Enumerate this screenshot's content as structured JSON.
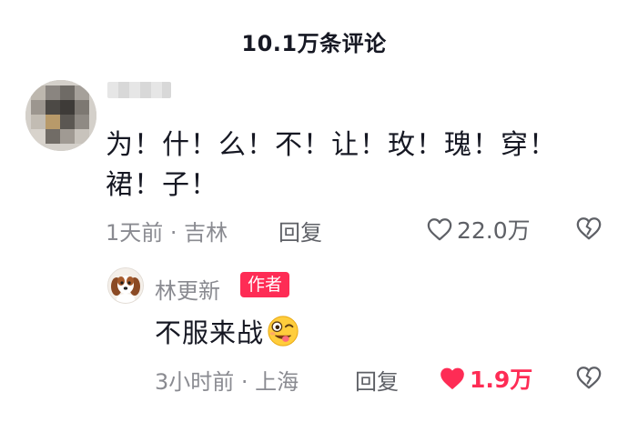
{
  "header": {
    "title": "10.1万条评论"
  },
  "comment": {
    "avatar": "blurred-avatar",
    "text": "为！什！么！不！让！玫！瑰！穿！裙！子！",
    "time_location": "1天前 · 吉林",
    "reply_label": "回复",
    "like_count": "22.0万",
    "liked": false
  },
  "reply": {
    "username": "林更新",
    "badge": "作者",
    "text": "不服来战",
    "emoji": "wink-tongue-emoji",
    "time_location": "3小时前 · 上海",
    "reply_label": "回复",
    "like_count": "1.9万",
    "liked": true
  },
  "colors": {
    "accent": "#fe2c55",
    "text_primary": "#161823",
    "text_secondary": "#8a8b91"
  }
}
